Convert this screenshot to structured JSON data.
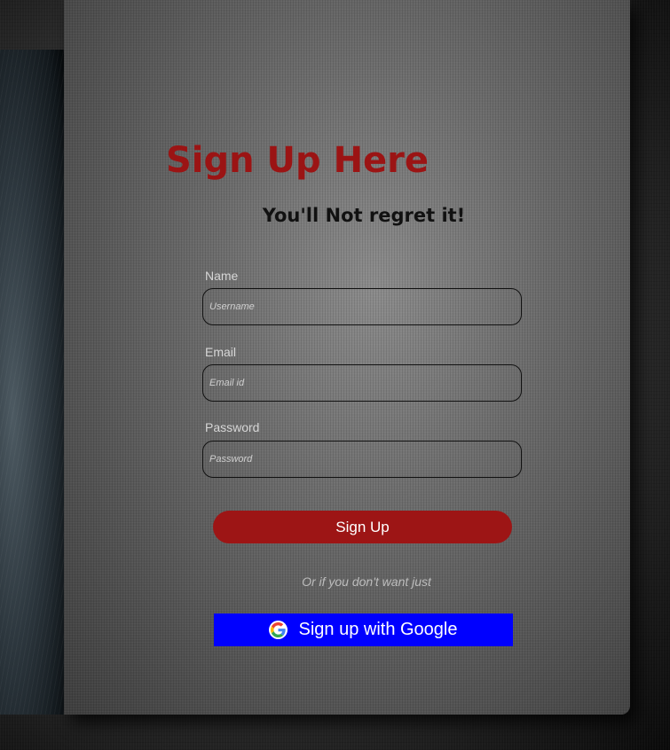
{
  "header": {
    "title": "Sign Up Here",
    "subtitle": "You'll Not regret it!"
  },
  "form": {
    "name": {
      "label": "Name",
      "placeholder": "Username",
      "value": ""
    },
    "email": {
      "label": "Email",
      "placeholder": "Email id",
      "value": ""
    },
    "password": {
      "label": "Password",
      "placeholder": "Password",
      "value": ""
    },
    "submit_label": "Sign Up"
  },
  "alternative": {
    "text": "Or if you don't want just",
    "google_label": "Sign up with Google",
    "google_icon": "google-g-icon"
  },
  "colors": {
    "title": "#9b1414",
    "submit_button": "#9d1515",
    "google_button": "#0000ff"
  }
}
